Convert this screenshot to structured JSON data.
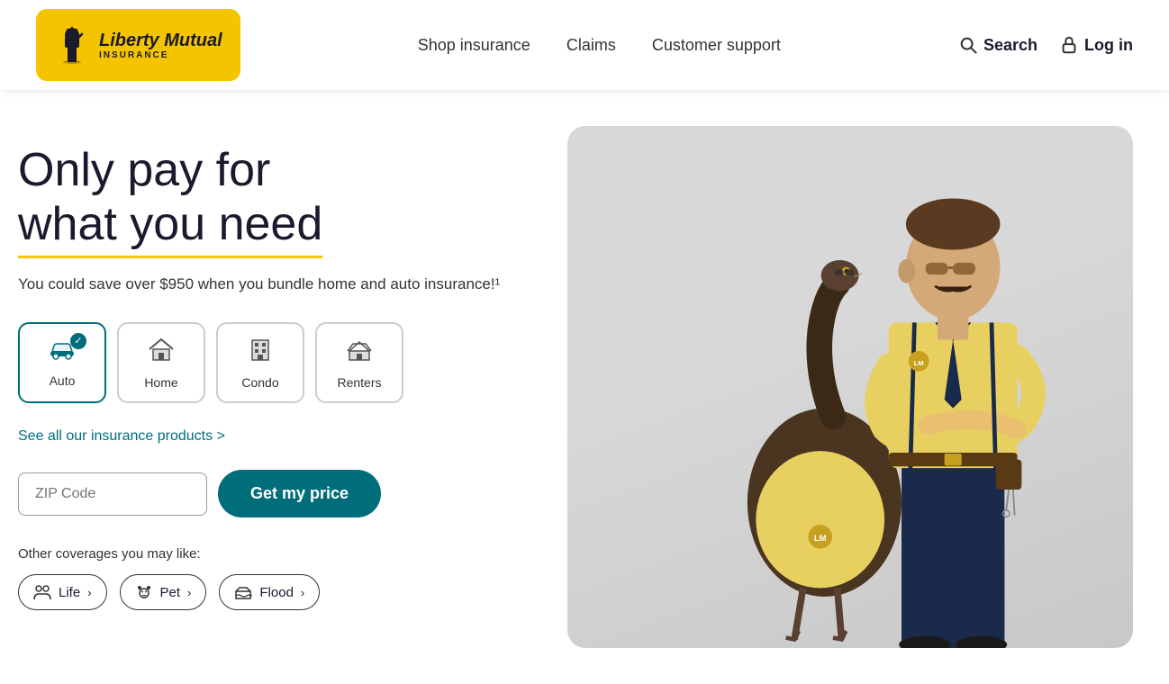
{
  "logo": {
    "name": "Liberty Mutual",
    "subtitle": "INSURANCE",
    "icon": "🗽"
  },
  "nav": {
    "links": [
      {
        "id": "shop-insurance",
        "label": "Shop insurance"
      },
      {
        "id": "claims",
        "label": "Claims"
      },
      {
        "id": "customer-support",
        "label": "Customer support"
      }
    ]
  },
  "header_actions": {
    "search_label": "Search",
    "login_label": "Log in"
  },
  "hero": {
    "headline_line1": "Only pay for",
    "headline_line2": "what you need",
    "subtext": "You could save over $950 when you bundle home and auto insurance!¹",
    "see_all_label": "See all our insurance products >",
    "zip_placeholder": "ZIP Code",
    "cta_label": "Get my price",
    "other_coverages_label": "Other coverages you may like:"
  },
  "insurance_tabs": [
    {
      "id": "auto",
      "label": "Auto",
      "icon": "🚗",
      "active": true
    },
    {
      "id": "home",
      "label": "Home",
      "icon": "🏠",
      "active": false
    },
    {
      "id": "condo",
      "label": "Condo",
      "icon": "🏢",
      "active": false
    },
    {
      "id": "renters",
      "label": "Renters",
      "icon": "🏘",
      "active": false
    }
  ],
  "coverage_pills": [
    {
      "id": "life",
      "label": "Life",
      "icon": "👥"
    },
    {
      "id": "pet",
      "label": "Pet",
      "icon": "🐾"
    },
    {
      "id": "flood",
      "label": "Flood",
      "icon": "🏚"
    }
  ]
}
